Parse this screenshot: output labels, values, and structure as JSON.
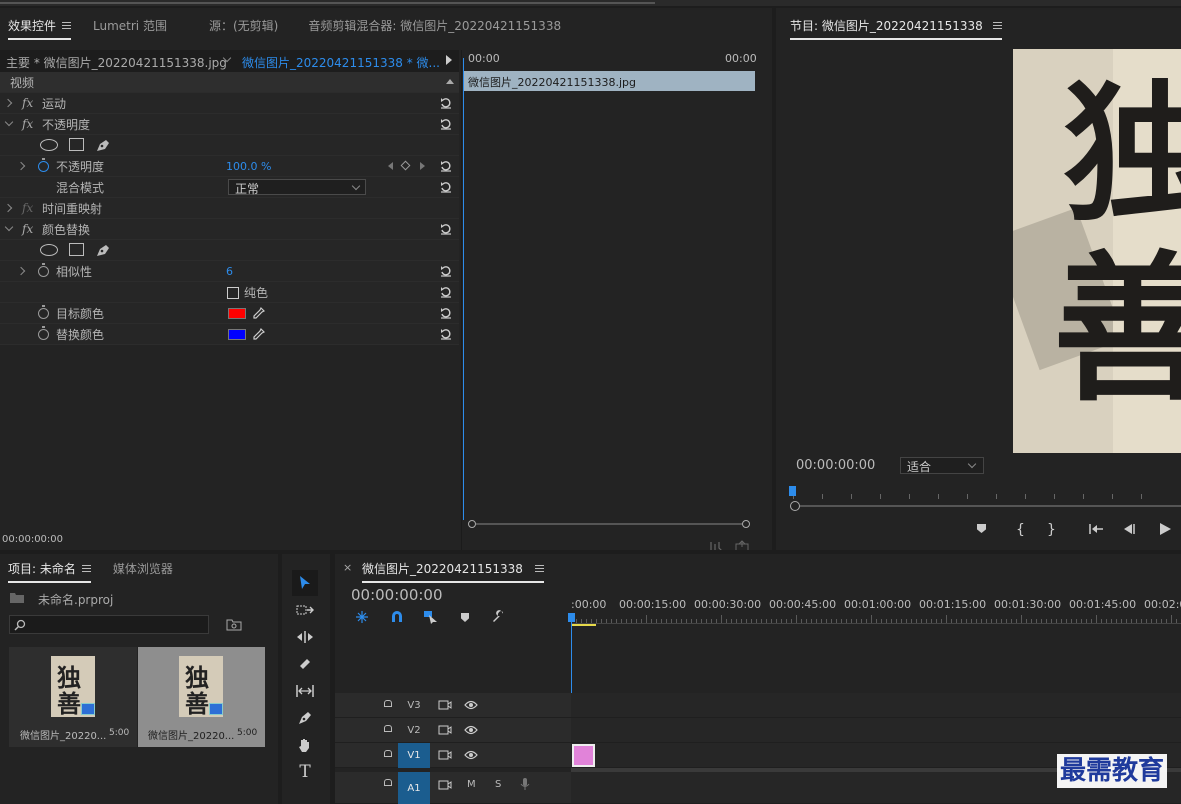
{
  "effects_panel": {
    "tabs": [
      {
        "label": "效果控件",
        "active": true
      },
      {
        "label": "Lumetri 范围",
        "active": false
      },
      {
        "label": "源：(无剪辑)",
        "active": false
      },
      {
        "label": "音频剪辑混合器: 微信图片_20220421151338",
        "active": false
      }
    ],
    "master_clip": "主要 * 微信图片_20220421151338.jpg",
    "sequence_clip": "微信图片_20220421151338 * 微...",
    "section_video": "视频",
    "effects": {
      "motion": "运动",
      "opacity": "不透明度",
      "opacity_prop": "不透明度",
      "opacity_value": "100.0 %",
      "blend_mode_label": "混合模式",
      "blend_mode_value": "正常",
      "time_remap": "时间重映射",
      "color_replace": "颜色替换",
      "similarity_label": "相似性",
      "similarity_value": "6",
      "solid_color_label": "纯色",
      "target_color_label": "目标颜色",
      "replace_color_label": "替换颜色",
      "target_color": "#ff0000",
      "replace_color": "#0000ff",
      "fx": "fx"
    },
    "timeline": {
      "start": "00:00",
      "end": "00:00",
      "clip_label": "微信图片_20220421151338.jpg"
    },
    "timecode": "00:00:00:00"
  },
  "program_monitor": {
    "title": "节目: 微信图片_20220421151338",
    "timecode": "00:00:00:00",
    "fit_label": "适合",
    "calligraphy_chars": [
      "独",
      "善"
    ]
  },
  "project_panel": {
    "tabs": [
      {
        "label": "项目: 未命名",
        "active": true
      },
      {
        "label": "媒体浏览器",
        "active": false
      }
    ],
    "project_file": "未命名.prproj",
    "items": [
      {
        "name": "微信图片_20220...",
        "duration": "5:00",
        "selected": false
      },
      {
        "name": "微信图片_20220...",
        "duration": "5:00",
        "selected": true
      }
    ]
  },
  "sequence_panel": {
    "title": "微信图片_20220421151338",
    "timecode": "00:00:00:00",
    "ruler": [
      ":00:00",
      "00:00:15:00",
      "00:00:30:00",
      "00:00:45:00",
      "00:01:00:00",
      "00:01:15:00",
      "00:01:30:00",
      "00:01:45:00",
      "00:02:0"
    ],
    "tracks": [
      {
        "name": "V3",
        "active": false
      },
      {
        "name": "V2",
        "active": false
      },
      {
        "name": "V1",
        "active": true
      },
      {
        "name": "A1",
        "active": true
      }
    ],
    "audio_m": "M",
    "audio_s": "S",
    "clip_color": "#e183d9"
  },
  "watermark": "最需教育"
}
